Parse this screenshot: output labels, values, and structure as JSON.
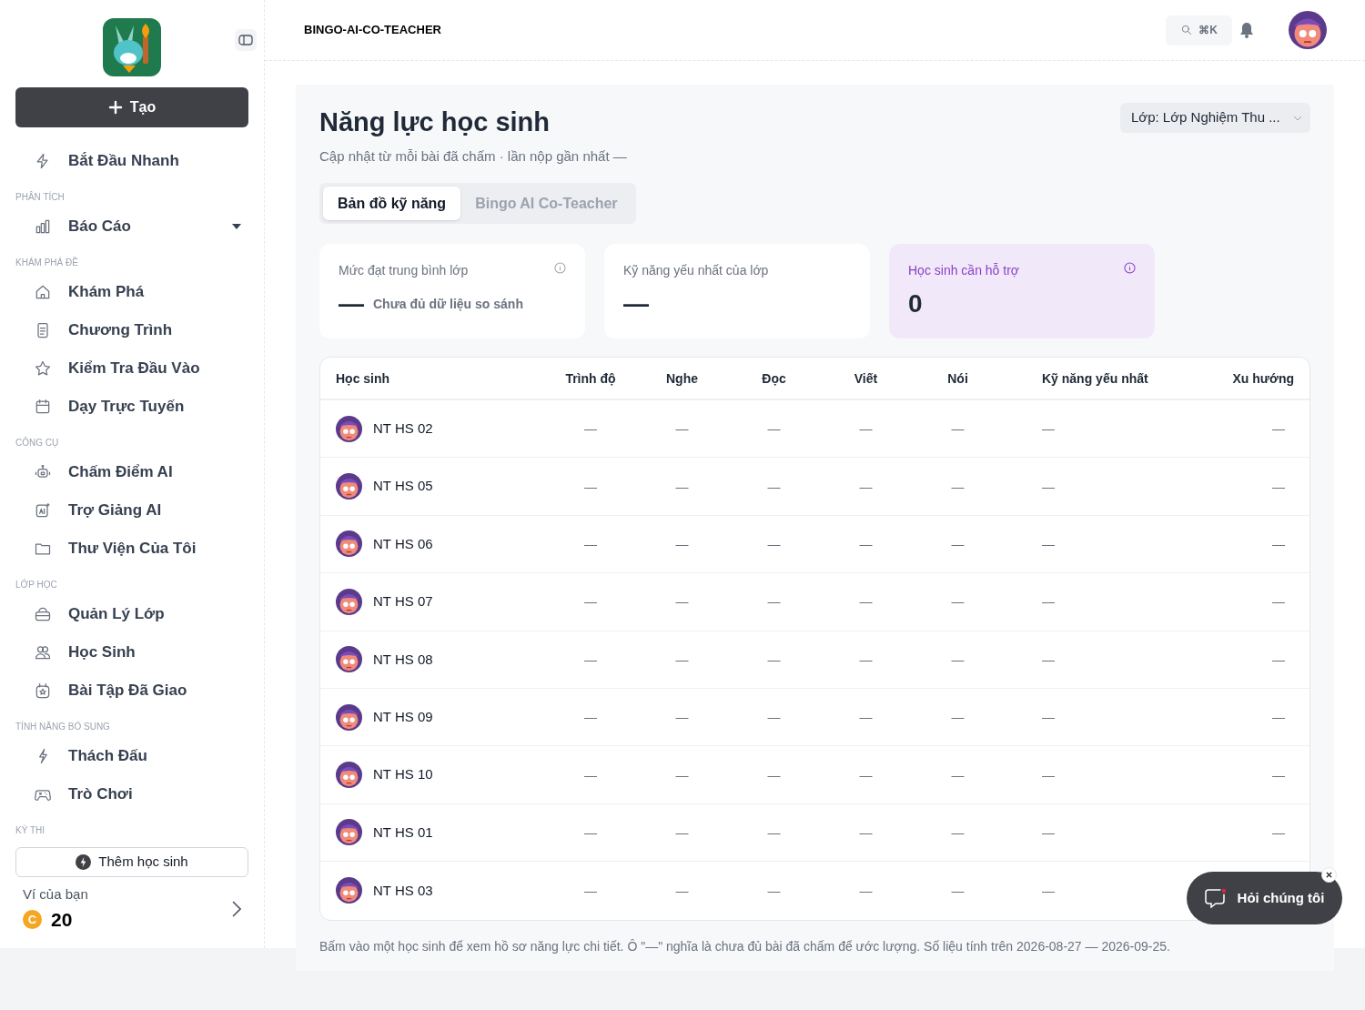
{
  "sidebar": {
    "create_button": "Tạo",
    "sections": [
      {
        "items": [
          {
            "label": "Bắt Đầu Nhanh"
          }
        ]
      },
      {
        "header": "PHÂN TÍCH",
        "items": [
          {
            "label": "Báo Cáo",
            "kind": "group",
            "expanded": false
          }
        ]
      },
      {
        "header": "KHÁM PHÁ ĐỀ",
        "items": [
          {
            "label": "Khám Phá"
          },
          {
            "label": "Chương Trình"
          },
          {
            "label": "Kiểm Tra Đầu Vào"
          },
          {
            "label": "Dạy Trực Tuyến"
          }
        ]
      },
      {
        "header": "CÔNG CỤ",
        "items": [
          {
            "label": "Chấm Điểm AI"
          },
          {
            "label": "Trợ Giảng AI"
          },
          {
            "label": "Thư Viện Của Tôi"
          }
        ]
      },
      {
        "header": "LỚP HỌC",
        "items": [
          {
            "label": "Quản Lý Lớp"
          },
          {
            "label": "Học Sinh"
          },
          {
            "label": "Bài Tập Đã Giao"
          }
        ]
      },
      {
        "header": "TÍNH NĂNG BỔ SUNG",
        "items": [
          {
            "label": "Thách Đấu"
          },
          {
            "label": "Trò Chơi"
          }
        ]
      },
      {
        "header": "KỲ THI"
      }
    ],
    "add_students_button": "Thêm học sinh",
    "wallet": {
      "label": "Ví của bạn",
      "coin": "C",
      "amount": "20"
    }
  },
  "header": {
    "title": "BINGO-AI-CO-TEACHER",
    "search_shortcut": "⌘K"
  },
  "page": {
    "title": "Năng lực học sinh",
    "subtitle": "Cập nhật từ mỗi bài đã chấm · lần nộp gần nhất —",
    "class_select": "Lớp: Lớp Nghiệm Thu ...",
    "tabs": [
      {
        "label": "Bản đồ kỹ năng",
        "selected": true
      },
      {
        "label": "Bingo AI Co-Teacher",
        "selected": false
      }
    ],
    "cards": [
      {
        "label": "Mức đạt trung bình lớp",
        "value": "—",
        "note": "Chưa đủ dữ liệu so sánh",
        "info": true,
        "highlight": false
      },
      {
        "label": "Kỹ năng yếu nhất của lớp",
        "value": "—",
        "info": false,
        "highlight": false
      },
      {
        "label": "Học sinh cần hỗ trợ",
        "value": "0",
        "info": true,
        "highlight": true
      }
    ],
    "table": {
      "columns": [
        "Học sinh",
        "Trình độ",
        "Nghe",
        "Đọc",
        "Viết",
        "Nói",
        "Kỹ năng yếu nhất",
        "Xu hướng"
      ],
      "rows": [
        {
          "cells": [
            "NT HS 02",
            "—",
            "—",
            "—",
            "—",
            "—",
            "—",
            "—"
          ]
        },
        {
          "cells": [
            "NT HS 05",
            "—",
            "—",
            "—",
            "—",
            "—",
            "—",
            "—"
          ]
        },
        {
          "cells": [
            "NT HS 06",
            "—",
            "—",
            "—",
            "—",
            "—",
            "—",
            "—"
          ]
        },
        {
          "cells": [
            "NT HS 07",
            "—",
            "—",
            "—",
            "—",
            "—",
            "—",
            "—"
          ]
        },
        {
          "cells": [
            "NT HS 08",
            "—",
            "—",
            "—",
            "—",
            "—",
            "—",
            "—"
          ]
        },
        {
          "cells": [
            "NT HS 09",
            "—",
            "—",
            "—",
            "—",
            "—",
            "—",
            "—"
          ]
        },
        {
          "cells": [
            "NT HS 10",
            "—",
            "—",
            "—",
            "—",
            "—",
            "—",
            "—"
          ]
        },
        {
          "cells": [
            "NT HS 01",
            "—",
            "—",
            "—",
            "—",
            "—",
            "—",
            "—"
          ]
        },
        {
          "cells": [
            "NT HS 03",
            "—",
            "—",
            "—",
            "—",
            "—",
            "—"
          ]
        }
      ]
    },
    "footnote": "Bấm vào một học sinh để xem hồ sơ năng lực chi tiết. Ô \"—\" nghĩa là chưa đủ bài đã chấm để ước lượng. Số liệu tính trên 2026-08-27 — 2026-09-25."
  },
  "chat_button": "Hỏi chúng tôi"
}
